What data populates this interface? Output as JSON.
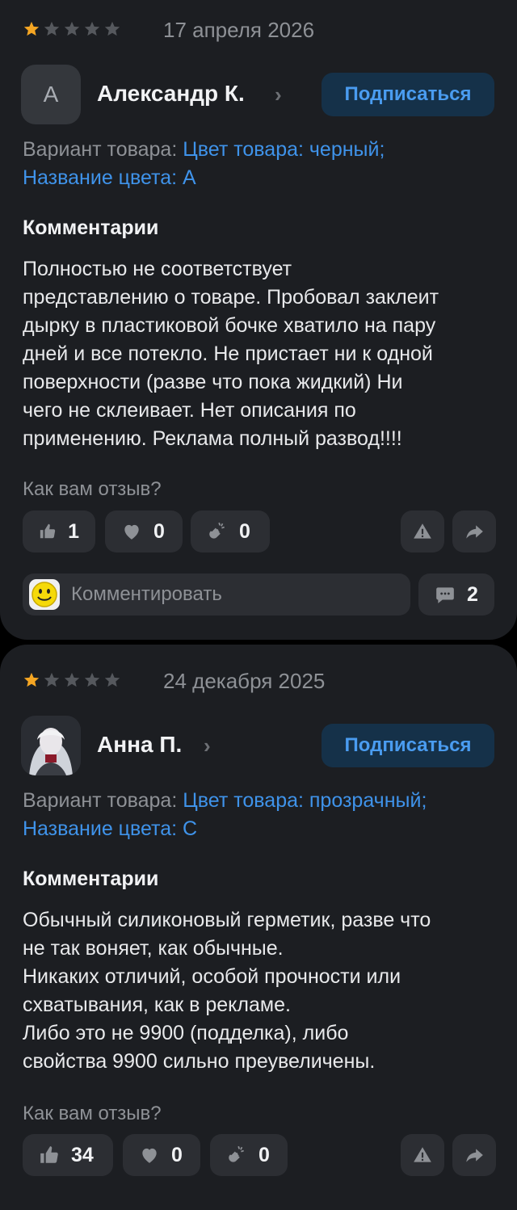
{
  "reviews": [
    {
      "rating": 1,
      "rating_max": 5,
      "date": "17 апреля 2026",
      "author": "Александр К.",
      "avatar_letter": "А",
      "subscribe_label": "Подписаться",
      "variant_label": "Вариант товара:",
      "variant_value_1": "Цвет товара: черный;",
      "variant_value_2": "Название цвета: A",
      "comments_heading": "Комментарии",
      "text": "Полностью не соответствует\nпредставлению о товаре. Пробовал заклеит\nдырку в пластиковой бочке хватило на пару\nдней и все потекло. Не пристает ни к одной\nповерхности (разве что пока жидкий) Ни\nчего не склеивает. Нет описания по\nприменению. Реклама полный развод!!!!",
      "ask": "Как вам отзыв?",
      "likes": "1",
      "hearts": "0",
      "claps": "0",
      "comment_placeholder": "Комментировать",
      "comment_count": "2"
    },
    {
      "rating": 1,
      "rating_max": 5,
      "date": "24 декабря 2025",
      "author": "Анна П.",
      "subscribe_label": "Подписаться",
      "variant_label": "Вариант товара:",
      "variant_value_1": "Цвет товара: прозрачный;",
      "variant_value_2": "Название цвета: C",
      "comments_heading": "Комментарии",
      "text": "Обычный силиконовый герметик, разве что\nне так воняет, как обычные.\nНикаких отличий, особой прочности или\nсхватывания, как в рекламе.\nЛибо это не  9900 (подделка), либо\nсвойства  9900 сильно преувеличены.",
      "ask": "Как вам отзыв?",
      "likes": "34",
      "hearts": "0",
      "claps": "0"
    }
  ],
  "colors": {
    "card": "#1c1e22",
    "accent": "#3f93ea",
    "star_filled": "#f5a623",
    "star_empty": "#55585d"
  },
  "icons": [
    "star-icon",
    "chevron-right-icon",
    "thumbs-up-icon",
    "heart-icon",
    "clap-icon",
    "warning-icon",
    "share-icon",
    "chat-icon",
    "smiley-icon"
  ]
}
